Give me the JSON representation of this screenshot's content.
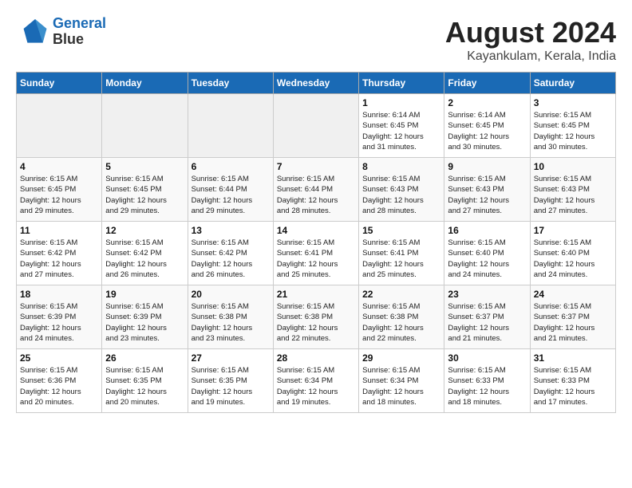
{
  "header": {
    "logo_line1": "General",
    "logo_line2": "Blue",
    "month": "August 2024",
    "location": "Kayankulam, Kerala, India"
  },
  "days_of_week": [
    "Sunday",
    "Monday",
    "Tuesday",
    "Wednesday",
    "Thursday",
    "Friday",
    "Saturday"
  ],
  "weeks": [
    [
      {
        "num": "",
        "info": ""
      },
      {
        "num": "",
        "info": ""
      },
      {
        "num": "",
        "info": ""
      },
      {
        "num": "",
        "info": ""
      },
      {
        "num": "1",
        "info": "Sunrise: 6:14 AM\nSunset: 6:45 PM\nDaylight: 12 hours\nand 31 minutes."
      },
      {
        "num": "2",
        "info": "Sunrise: 6:14 AM\nSunset: 6:45 PM\nDaylight: 12 hours\nand 30 minutes."
      },
      {
        "num": "3",
        "info": "Sunrise: 6:15 AM\nSunset: 6:45 PM\nDaylight: 12 hours\nand 30 minutes."
      }
    ],
    [
      {
        "num": "4",
        "info": "Sunrise: 6:15 AM\nSunset: 6:45 PM\nDaylight: 12 hours\nand 29 minutes."
      },
      {
        "num": "5",
        "info": "Sunrise: 6:15 AM\nSunset: 6:45 PM\nDaylight: 12 hours\nand 29 minutes."
      },
      {
        "num": "6",
        "info": "Sunrise: 6:15 AM\nSunset: 6:44 PM\nDaylight: 12 hours\nand 29 minutes."
      },
      {
        "num": "7",
        "info": "Sunrise: 6:15 AM\nSunset: 6:44 PM\nDaylight: 12 hours\nand 28 minutes."
      },
      {
        "num": "8",
        "info": "Sunrise: 6:15 AM\nSunset: 6:43 PM\nDaylight: 12 hours\nand 28 minutes."
      },
      {
        "num": "9",
        "info": "Sunrise: 6:15 AM\nSunset: 6:43 PM\nDaylight: 12 hours\nand 27 minutes."
      },
      {
        "num": "10",
        "info": "Sunrise: 6:15 AM\nSunset: 6:43 PM\nDaylight: 12 hours\nand 27 minutes."
      }
    ],
    [
      {
        "num": "11",
        "info": "Sunrise: 6:15 AM\nSunset: 6:42 PM\nDaylight: 12 hours\nand 27 minutes."
      },
      {
        "num": "12",
        "info": "Sunrise: 6:15 AM\nSunset: 6:42 PM\nDaylight: 12 hours\nand 26 minutes."
      },
      {
        "num": "13",
        "info": "Sunrise: 6:15 AM\nSunset: 6:42 PM\nDaylight: 12 hours\nand 26 minutes."
      },
      {
        "num": "14",
        "info": "Sunrise: 6:15 AM\nSunset: 6:41 PM\nDaylight: 12 hours\nand 25 minutes."
      },
      {
        "num": "15",
        "info": "Sunrise: 6:15 AM\nSunset: 6:41 PM\nDaylight: 12 hours\nand 25 minutes."
      },
      {
        "num": "16",
        "info": "Sunrise: 6:15 AM\nSunset: 6:40 PM\nDaylight: 12 hours\nand 24 minutes."
      },
      {
        "num": "17",
        "info": "Sunrise: 6:15 AM\nSunset: 6:40 PM\nDaylight: 12 hours\nand 24 minutes."
      }
    ],
    [
      {
        "num": "18",
        "info": "Sunrise: 6:15 AM\nSunset: 6:39 PM\nDaylight: 12 hours\nand 24 minutes."
      },
      {
        "num": "19",
        "info": "Sunrise: 6:15 AM\nSunset: 6:39 PM\nDaylight: 12 hours\nand 23 minutes."
      },
      {
        "num": "20",
        "info": "Sunrise: 6:15 AM\nSunset: 6:38 PM\nDaylight: 12 hours\nand 23 minutes."
      },
      {
        "num": "21",
        "info": "Sunrise: 6:15 AM\nSunset: 6:38 PM\nDaylight: 12 hours\nand 22 minutes."
      },
      {
        "num": "22",
        "info": "Sunrise: 6:15 AM\nSunset: 6:38 PM\nDaylight: 12 hours\nand 22 minutes."
      },
      {
        "num": "23",
        "info": "Sunrise: 6:15 AM\nSunset: 6:37 PM\nDaylight: 12 hours\nand 21 minutes."
      },
      {
        "num": "24",
        "info": "Sunrise: 6:15 AM\nSunset: 6:37 PM\nDaylight: 12 hours\nand 21 minutes."
      }
    ],
    [
      {
        "num": "25",
        "info": "Sunrise: 6:15 AM\nSunset: 6:36 PM\nDaylight: 12 hours\nand 20 minutes."
      },
      {
        "num": "26",
        "info": "Sunrise: 6:15 AM\nSunset: 6:35 PM\nDaylight: 12 hours\nand 20 minutes."
      },
      {
        "num": "27",
        "info": "Sunrise: 6:15 AM\nSunset: 6:35 PM\nDaylight: 12 hours\nand 19 minutes."
      },
      {
        "num": "28",
        "info": "Sunrise: 6:15 AM\nSunset: 6:34 PM\nDaylight: 12 hours\nand 19 minutes."
      },
      {
        "num": "29",
        "info": "Sunrise: 6:15 AM\nSunset: 6:34 PM\nDaylight: 12 hours\nand 18 minutes."
      },
      {
        "num": "30",
        "info": "Sunrise: 6:15 AM\nSunset: 6:33 PM\nDaylight: 12 hours\nand 18 minutes."
      },
      {
        "num": "31",
        "info": "Sunrise: 6:15 AM\nSunset: 6:33 PM\nDaylight: 12 hours\nand 17 minutes."
      }
    ]
  ]
}
